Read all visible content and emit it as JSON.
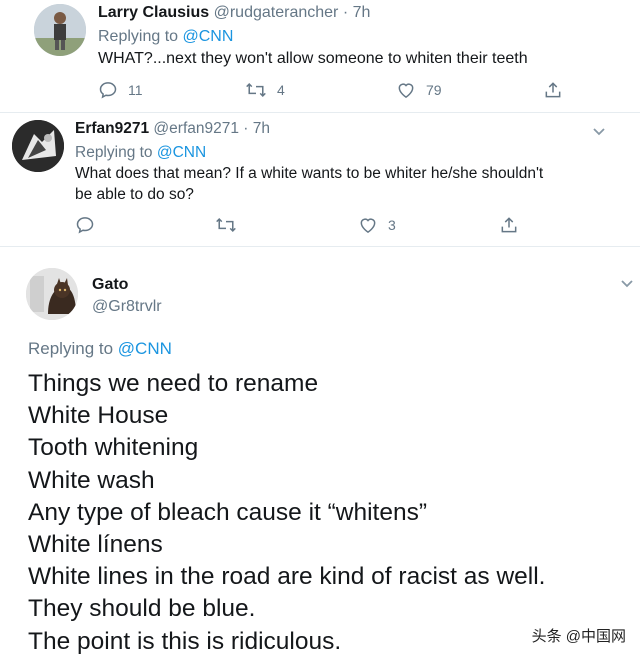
{
  "tweets": [
    {
      "name": "Larry Clausius",
      "handle": "@rudgaterancher",
      "time": "· 7h",
      "replying_prefix": "Replying to",
      "replying_to": "@CNN",
      "text": "WHAT?...next they won't allow someone to whiten their teeth",
      "replies": "11",
      "retweets": "4",
      "likes": "79"
    },
    {
      "name": "Erfan9271",
      "handle": "@erfan9271",
      "time": "· 7h",
      "replying_prefix": "Replying to",
      "replying_to": "@CNN",
      "text_line1": "What does that mean? If a white wants to be whiter he/she shouldn't",
      "text_line2": "be able to do so?",
      "replies": "",
      "retweets": "",
      "likes": "3"
    },
    {
      "name": "Gato",
      "handle": "@Gr8trvlr",
      "replying_prefix": "Replying to",
      "replying_to": "@CNN",
      "lines": [
        "Things we need to rename",
        "White House",
        "Tooth whitening",
        "White wash",
        "Any type of bleach cause it “whitens”",
        "White línens",
        "White lines in the road are kind of racist as well.",
        "They should be blue.",
        "The point is this is ridiculous."
      ]
    }
  ],
  "watermark": "头条 @中国网",
  "colors": {
    "link": "#1b95e0",
    "muted": "#657786",
    "text": "#14171a"
  },
  "icons": [
    "reply-icon",
    "retweet-icon",
    "like-icon",
    "share-icon",
    "chevron-down-icon"
  ]
}
